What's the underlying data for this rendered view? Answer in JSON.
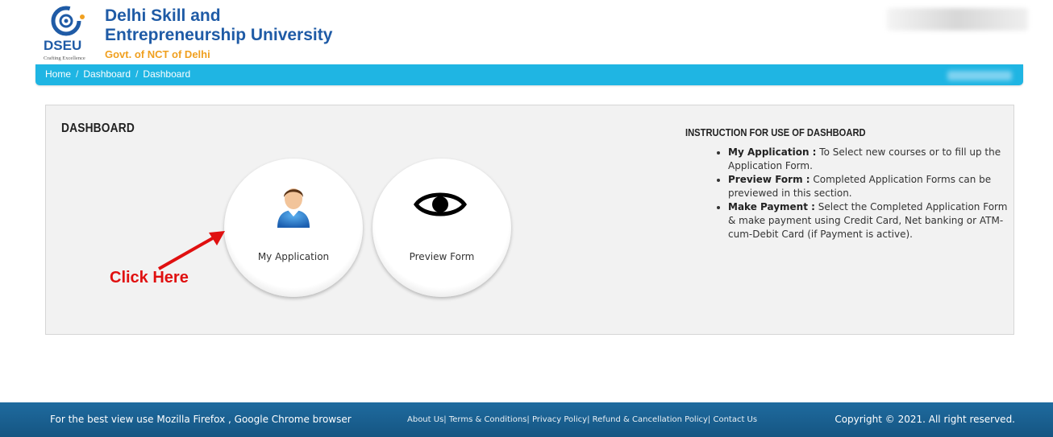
{
  "header": {
    "title_line1": "Delhi Skill and",
    "title_line2": "Entrepreneurship University",
    "subtitle": "Govt. of NCT of Delhi",
    "logo_text": "DSEU",
    "logo_tagline": "Crafting Excellence"
  },
  "breadcrumb": [
    "Home",
    "Dashboard",
    "Dashboard"
  ],
  "dashboard": {
    "title": "DASHBOARD",
    "tiles": [
      {
        "label": "My Application",
        "icon": "person-icon"
      },
      {
        "label": "Preview Form",
        "icon": "eye-icon"
      }
    ],
    "annotation": "Click Here",
    "annotation_color": "#e01010"
  },
  "instructions": {
    "title": "INSTRUCTION FOR USE OF DASHBOARD",
    "items": [
      {
        "term": "My Application :",
        "text": " To Select new courses or to fill up the Application Form."
      },
      {
        "term": "Preview Form :",
        "text": " Completed Application Forms can be previewed in this section."
      },
      {
        "term": "Make Payment :",
        "text": " Select the Completed Application Form & make payment using Credit Card, Net banking or ATM-cum-Debit Card (if Payment is active)."
      }
    ]
  },
  "footer": {
    "left": "For the best view use Mozilla Firefox , Google Chrome browser",
    "links": [
      "About Us",
      "Terms & Conditions",
      "Privacy Policy",
      "Refund & Cancellation Policy",
      "Contact Us"
    ],
    "right": "Copyright © 2021. All right reserved."
  },
  "colors": {
    "brand_blue": "#1f5ba6",
    "accent_cyan": "#1fb5e3",
    "footer_blue": "#155582"
  }
}
